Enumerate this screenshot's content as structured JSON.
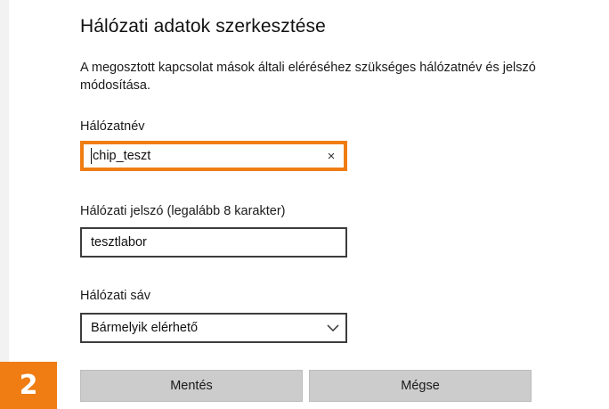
{
  "dialog": {
    "title": "Hálózati adatok szerkesztése",
    "description": "A megosztott kapcsolat mások általi eléréséhez szükséges hálózatnév és jelszó módosítása."
  },
  "network_name": {
    "label": "Hálózatnév",
    "value": "chip_teszt",
    "clear_icon": "×"
  },
  "password": {
    "label": "Hálózati jelszó (legalább 8 karakter)",
    "value": "tesztlabor"
  },
  "band": {
    "label": "Hálózati sáv",
    "selected": "Bármelyik elérhető"
  },
  "buttons": {
    "save": "Mentés",
    "cancel": "Mégse"
  },
  "step_badge": "2",
  "colors": {
    "accent": "#ef7d14",
    "button_bg": "#cccccc",
    "border": "#3c3c3c"
  }
}
